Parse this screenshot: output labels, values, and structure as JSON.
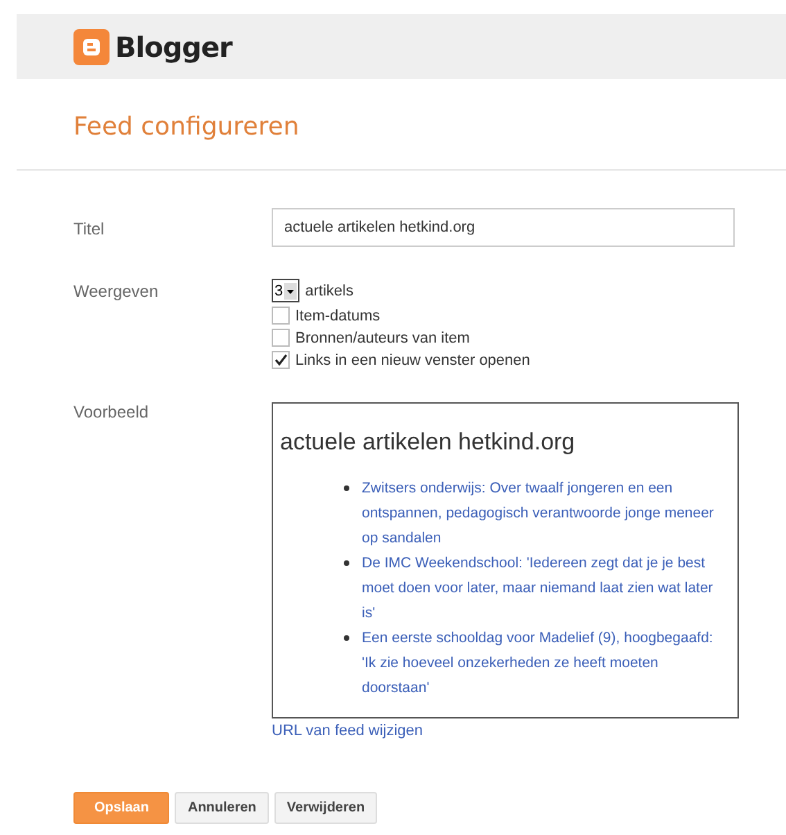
{
  "header": {
    "brand": "Blogger"
  },
  "heading": "Feed configureren",
  "fields": {
    "title_label": "Titel",
    "title_value": "actuele artikelen hetkind.org",
    "display_label": "Weergeven",
    "count": "3",
    "count_suffix": "artikels",
    "options": [
      {
        "label": "Item-datums",
        "checked": false
      },
      {
        "label": "Bronnen/auteurs van item",
        "checked": false
      },
      {
        "label": "Links in een nieuw venster openen",
        "checked": true
      }
    ]
  },
  "preview": {
    "label": "Voorbeeld",
    "title": "actuele artikelen hetkind.org",
    "items": [
      "Zwitsers onderwijs: Over twaalf jongeren en een ontspannen, pedagogisch verantwoorde jonge meneer op sandalen",
      "De IMC Weekendschool: 'Iedereen zegt dat je je best moet doen voor later, maar niemand laat zien wat later is'",
      "Een eerste schooldag voor Madelief (9), hoogbegaafd: 'Ik zie hoeveel onzekerheden ze heeft moeten doorstaan'"
    ],
    "change_link": "URL van feed wijzigen"
  },
  "buttons": [
    {
      "label": "Opslaan",
      "kind": "primary"
    },
    {
      "label": "Annuleren",
      "kind": "secondary"
    },
    {
      "label": "Verwijderen",
      "kind": "secondary"
    }
  ]
}
